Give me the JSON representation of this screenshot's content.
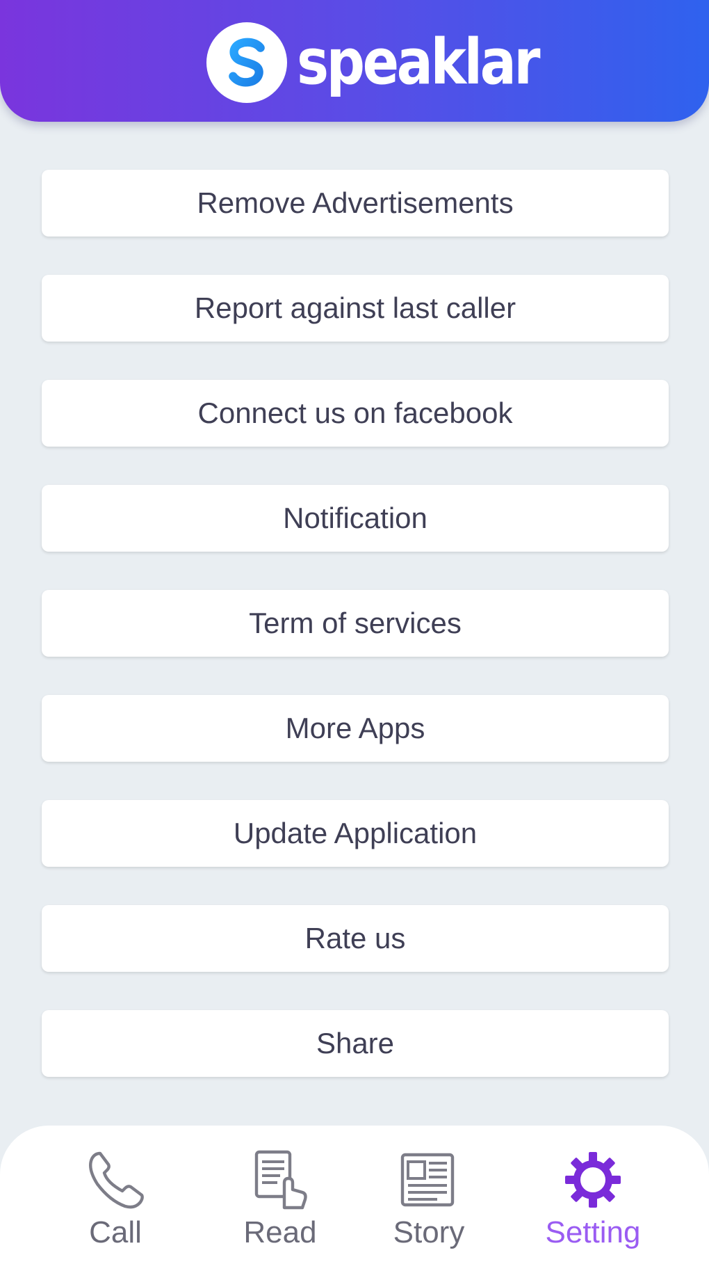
{
  "header": {
    "app_name": "speaklar",
    "logo_letter": "S",
    "gradient": [
      "#7a35dd",
      "#2f62ee"
    ]
  },
  "menu": {
    "items": [
      {
        "label": "Remove Advertisements"
      },
      {
        "label": "Report against last caller"
      },
      {
        "label": "Connect us on facebook"
      },
      {
        "label": "Notification"
      },
      {
        "label": "Term of services"
      },
      {
        "label": "More Apps"
      },
      {
        "label": "Update Application"
      },
      {
        "label": "Rate us"
      },
      {
        "label": "Share"
      }
    ]
  },
  "bottom_nav": {
    "active": "Setting",
    "active_color": "#7a2bd9",
    "items": [
      {
        "label": "Call",
        "icon": "phone-icon"
      },
      {
        "label": "Read",
        "icon": "read-icon"
      },
      {
        "label": "Story",
        "icon": "newspaper-icon"
      },
      {
        "label": "Setting",
        "icon": "gear-icon"
      }
    ]
  }
}
